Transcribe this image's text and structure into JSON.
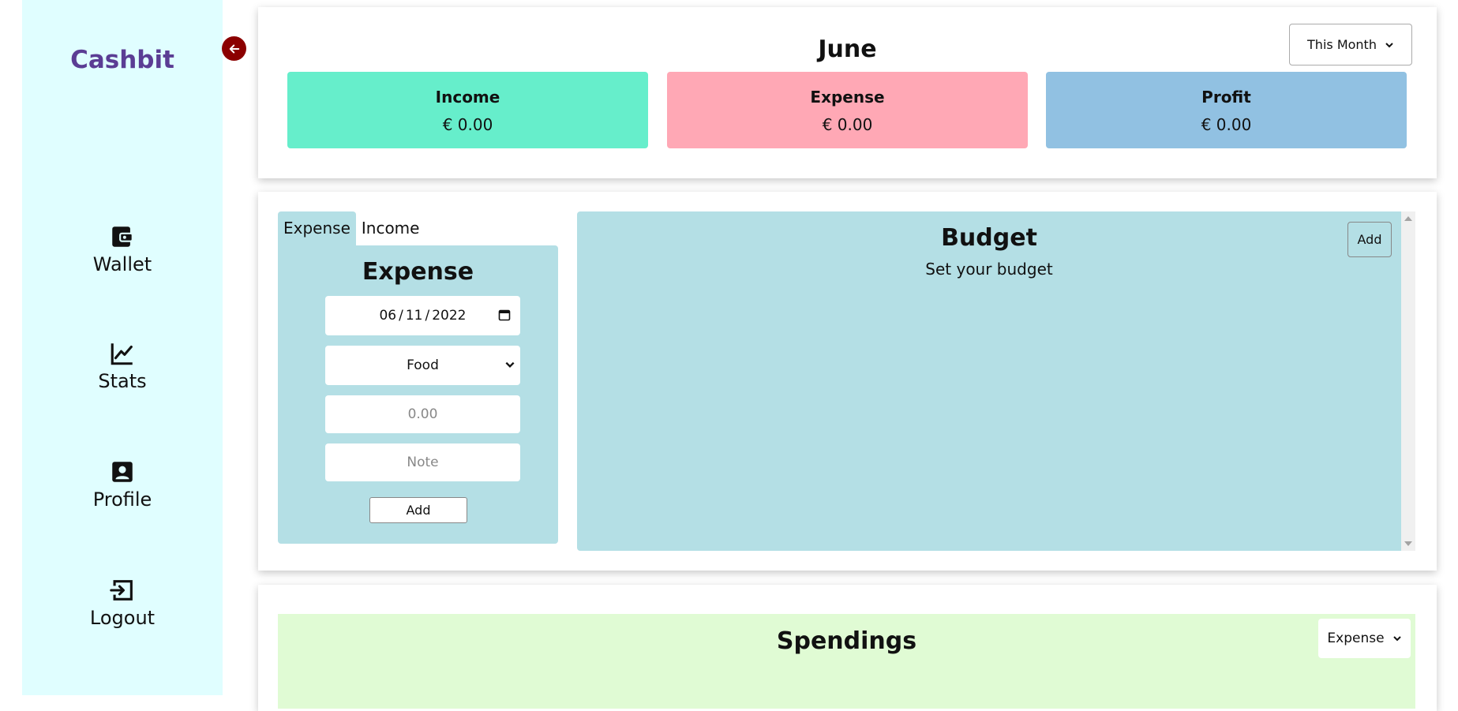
{
  "app": {
    "brand": "Cashbit"
  },
  "nav": {
    "items": [
      {
        "label": "Wallet",
        "icon": "wallet-icon"
      },
      {
        "label": "Stats",
        "icon": "chart-line-icon"
      },
      {
        "label": "Profile",
        "icon": "profile-icon"
      },
      {
        "label": "Logout",
        "icon": "logout-icon"
      }
    ]
  },
  "summary": {
    "month": "June",
    "period_select": "This Month",
    "income": {
      "label": "Income",
      "value": "€ 0.00"
    },
    "expense": {
      "label": "Expense",
      "value": "€ 0.00"
    },
    "profit": {
      "label": "Profit",
      "value": "€ 0.00"
    }
  },
  "entry": {
    "tabs": [
      "Expense",
      "Income"
    ],
    "active_tab": "Expense",
    "form_title": "Expense",
    "date_month": "06",
    "date_day": "11",
    "date_year": "2022",
    "category": "Food",
    "amount_placeholder": "0.00",
    "note_placeholder": "Note",
    "add_label": "Add"
  },
  "budget": {
    "title": "Budget",
    "subtitle": "Set your budget",
    "add_label": "Add"
  },
  "spendings": {
    "title": "Spendings",
    "type_select": "Expense"
  },
  "colors": {
    "sidebar_bg": "#e0feff",
    "brand": "#5b3d94",
    "collapse_button": "#8b0000",
    "income_card": "#66eecb",
    "expense_card": "#ffa8b5",
    "profit_card": "#91c1e2",
    "form_bg": "#b4dfe5",
    "spendings_bg": "#e0fbd4"
  }
}
